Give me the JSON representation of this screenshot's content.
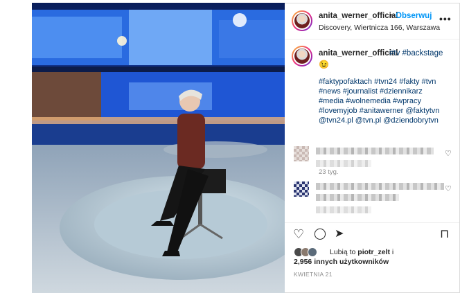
{
  "post": {
    "username": "anita_werner_official",
    "follow_label": "Obserwuj",
    "location": "Discovery, Wiertnicza 166, Warszawa",
    "more_label": "•••"
  },
  "caption": {
    "username": "anita_werner_official",
    "head_tags": "#tv #backstage",
    "emoji": "😉",
    "tag_lines": [
      "#faktypofaktach #tvn24 #fakty #tvn",
      "#news #journalist #dziennikarz",
      "#media #wolnemedia #wpracy",
      "#lovemyjob #anitawerner @faktytvn",
      "@tvn24.pl @tvn.pl @dziendobrytvn"
    ],
    "age": "23 tyg."
  },
  "comments": [
    {
      "icon": "heart-outline-icon",
      "blurred": true
    },
    {
      "icon": "heart-outline-icon",
      "blurred": true
    }
  ],
  "actions": {
    "like": "♡",
    "comment": "◯",
    "share": "➤",
    "save": "⊓"
  },
  "likes": {
    "prefix": "Lubią to ",
    "user": "piotr_zelt",
    "suffix": " i",
    "count_line": "2,956 innych użytkowników"
  },
  "date": "KWIETNIA 21",
  "colors": {
    "accent": "#0095f6",
    "link": "#00376b",
    "muted": "#8e8e8e"
  }
}
